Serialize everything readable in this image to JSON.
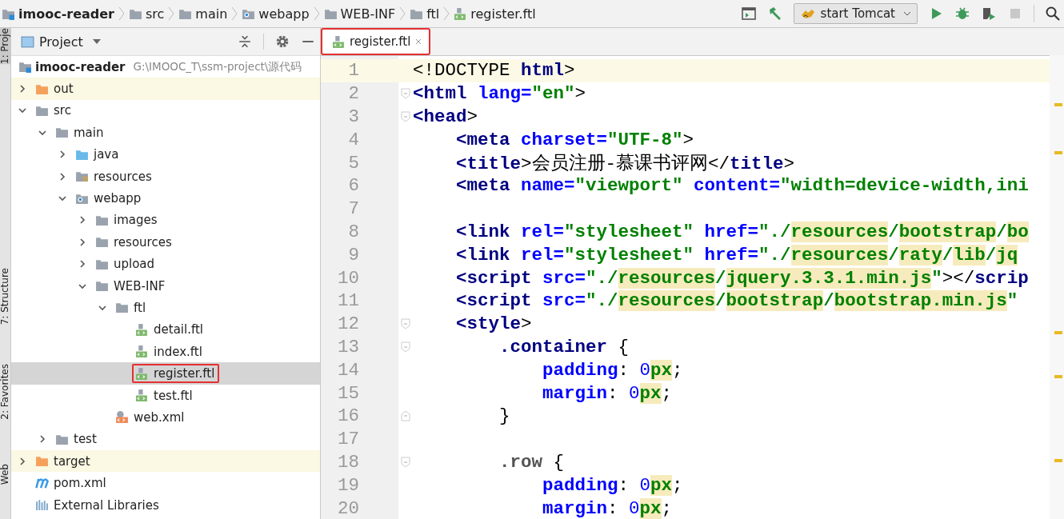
{
  "breadcrumbs": [
    {
      "label": "imooc-reader",
      "kind": "module"
    },
    {
      "label": "src",
      "kind": "folder"
    },
    {
      "label": "main",
      "kind": "folder"
    },
    {
      "label": "webapp",
      "kind": "web"
    },
    {
      "label": "WEB-INF",
      "kind": "folder"
    },
    {
      "label": "ftl",
      "kind": "folder"
    },
    {
      "label": "register.ftl",
      "kind": "ftl"
    }
  ],
  "run_config": {
    "label": "start Tomcat"
  },
  "side_tabs": [
    {
      "label": "1: Proje",
      "selected": true
    },
    {
      "label": "7: Structure",
      "selected": false
    },
    {
      "label": "2: Favorites",
      "selected": false
    },
    {
      "label": "Web",
      "selected": false
    }
  ],
  "project_panel": {
    "title": "Project"
  },
  "editor_tabs": [
    {
      "label": "register.ftl",
      "selected": true,
      "outlined": true
    }
  ],
  "project_root": {
    "label": "imooc-reader",
    "location": "G:\\IMOOC_T\\ssm-project\\源代码"
  },
  "tree": [
    {
      "label": "out",
      "kind": "excluded",
      "expanded": false
    },
    {
      "label": "src",
      "kind": "folder",
      "expanded": true,
      "children": [
        {
          "label": "main",
          "kind": "folder",
          "expanded": true,
          "children": [
            {
              "label": "java",
              "kind": "source",
              "expanded": false
            },
            {
              "label": "resources",
              "kind": "resources",
              "expanded": false
            },
            {
              "label": "webapp",
              "kind": "web",
              "expanded": true,
              "children": [
                {
                  "label": "images",
                  "kind": "folder",
                  "expanded": false
                },
                {
                  "label": "resources",
                  "kind": "folder",
                  "expanded": false
                },
                {
                  "label": "upload",
                  "kind": "folder",
                  "expanded": false
                },
                {
                  "label": "WEB-INF",
                  "kind": "folder",
                  "expanded": true,
                  "children": [
                    {
                      "label": "ftl",
                      "kind": "folder",
                      "expanded": true,
                      "children": [
                        {
                          "label": "detail.ftl",
                          "kind": "ftl",
                          "selected": false,
                          "outlined": false
                        },
                        {
                          "label": "index.ftl",
                          "kind": "ftl",
                          "selected": false,
                          "outlined": false
                        },
                        {
                          "label": "register.ftl",
                          "kind": "ftl",
                          "selected": true,
                          "outlined": true
                        },
                        {
                          "label": "test.ftl",
                          "kind": "ftl",
                          "selected": false,
                          "outlined": false
                        }
                      ]
                    },
                    {
                      "label": "web.xml",
                      "kind": "xml",
                      "selected": false,
                      "outlined": false
                    }
                  ]
                }
              ]
            }
          ]
        },
        {
          "label": "test",
          "kind": "folder",
          "expanded": false
        }
      ]
    },
    {
      "label": "target",
      "kind": "excluded",
      "expanded": false
    },
    {
      "label": "pom.xml",
      "kind": "maven"
    },
    {
      "label": "External Libraries",
      "kind": "libraries"
    }
  ],
  "code": [
    {
      "n": "1",
      "current": true,
      "tokens": [
        {
          "t": "<!DOCTYPE ",
          "kind": "plain"
        },
        {
          "t": "html",
          "kind": "tag"
        },
        {
          "t": ">",
          "kind": "plain"
        }
      ]
    },
    {
      "n": "2",
      "current": false,
      "fold_start": true,
      "tokens": [
        {
          "t": "<html ",
          "kind": "tag"
        },
        {
          "t": "lang=",
          "kind": "attr"
        },
        {
          "t": "\"en\"",
          "kind": "str"
        },
        {
          "t": ">",
          "kind": "plain"
        }
      ]
    },
    {
      "n": "3",
      "current": false,
      "fold_start": true,
      "tokens": [
        {
          "t": "<head",
          "kind": "tag"
        },
        {
          "t": ">",
          "kind": "plain"
        }
      ]
    },
    {
      "n": "4",
      "current": false,
      "tokens": [
        {
          "t": "    <meta ",
          "kind": "tag"
        },
        {
          "t": "charset=",
          "kind": "attr"
        },
        {
          "t": "\"UTF-8\"",
          "kind": "str"
        },
        {
          "t": ">",
          "kind": "plain"
        }
      ]
    },
    {
      "n": "5",
      "current": false,
      "tokens": [
        {
          "t": "    <title",
          "kind": "tag"
        },
        {
          "t": ">会员注册-慕课书评网</",
          "kind": "plain"
        },
        {
          "t": "title",
          "kind": "tag"
        },
        {
          "t": ">",
          "kind": "plain"
        }
      ]
    },
    {
      "n": "6",
      "current": false,
      "tokens": [
        {
          "t": "    <meta ",
          "kind": "tag"
        },
        {
          "t": "name=",
          "kind": "attr"
        },
        {
          "t": "\"viewport\" ",
          "kind": "str"
        },
        {
          "t": "content=",
          "kind": "attr"
        },
        {
          "t": "\"width=device-width,ini",
          "kind": "str"
        }
      ]
    },
    {
      "n": "7",
      "current": false
    },
    {
      "n": "8",
      "current": false,
      "tokens": [
        {
          "t": "    <link ",
          "kind": "tag"
        },
        {
          "t": "rel=",
          "kind": "attr"
        },
        {
          "t": "\"stylesheet\" ",
          "kind": "str"
        },
        {
          "t": "href=",
          "kind": "attr"
        },
        {
          "t": "\"./",
          "kind": "str"
        },
        {
          "t": "resources",
          "kind": "path"
        },
        {
          "t": "/",
          "kind": "str"
        },
        {
          "t": "bootstrap",
          "kind": "path"
        },
        {
          "t": "/",
          "kind": "str"
        },
        {
          "t": "bo",
          "kind": "path"
        }
      ]
    },
    {
      "n": "9",
      "current": false,
      "tokens": [
        {
          "t": "    <link ",
          "kind": "tag"
        },
        {
          "t": "rel=",
          "kind": "attr"
        },
        {
          "t": "\"stylesheet\" ",
          "kind": "str"
        },
        {
          "t": "href=",
          "kind": "attr"
        },
        {
          "t": "\"./",
          "kind": "str"
        },
        {
          "t": "resources",
          "kind": "path"
        },
        {
          "t": "/",
          "kind": "str"
        },
        {
          "t": "raty",
          "kind": "path"
        },
        {
          "t": "/",
          "kind": "str"
        },
        {
          "t": "lib",
          "kind": "path"
        },
        {
          "t": "/",
          "kind": "str"
        },
        {
          "t": "jq",
          "kind": "path"
        }
      ]
    },
    {
      "n": "10",
      "current": false,
      "tokens": [
        {
          "t": "    <script ",
          "kind": "tag"
        },
        {
          "t": "src=",
          "kind": "attr"
        },
        {
          "t": "\"./",
          "kind": "str"
        },
        {
          "t": "resources",
          "kind": "path"
        },
        {
          "t": "/",
          "kind": "str"
        },
        {
          "t": "jquery.3.3.1.min.js",
          "kind": "path"
        },
        {
          "t": "\"",
          "kind": "str"
        },
        {
          "t": "></",
          "kind": "plain"
        },
        {
          "t": "scrip",
          "kind": "tag"
        }
      ]
    },
    {
      "n": "11",
      "current": false,
      "tokens": [
        {
          "t": "    <script ",
          "kind": "tag"
        },
        {
          "t": "src=",
          "kind": "attr"
        },
        {
          "t": "\"./",
          "kind": "str"
        },
        {
          "t": "resources",
          "kind": "path"
        },
        {
          "t": "/",
          "kind": "str"
        },
        {
          "t": "bootstrap",
          "kind": "path"
        },
        {
          "t": "/",
          "kind": "str"
        },
        {
          "t": "bootstrap.min.js",
          "kind": "path"
        },
        {
          "t": "\"",
          "kind": "str"
        }
      ]
    },
    {
      "n": "12",
      "current": false,
      "fold_start": true,
      "tokens": [
        {
          "t": "    <style",
          "kind": "tag"
        },
        {
          "t": ">",
          "kind": "plain"
        }
      ]
    },
    {
      "n": "13",
      "current": false,
      "fold_start": true,
      "tokens": [
        {
          "t": "        .container",
          "kind": "tag"
        },
        {
          "t": " {",
          "kind": "plain"
        }
      ]
    },
    {
      "n": "14",
      "current": false,
      "tokens": [
        {
          "t": "            padding",
          "kind": "attr"
        },
        {
          "t": ": ",
          "kind": "plain"
        },
        {
          "t": "0",
          "kind": "num"
        },
        {
          "t": "px",
          "kind": "unit"
        },
        {
          "t": ";",
          "kind": "plain"
        }
      ]
    },
    {
      "n": "15",
      "current": false,
      "tokens": [
        {
          "t": "            margin",
          "kind": "attr"
        },
        {
          "t": ": ",
          "kind": "plain"
        },
        {
          "t": "0",
          "kind": "num"
        },
        {
          "t": "px",
          "kind": "unit"
        },
        {
          "t": ";",
          "kind": "plain"
        }
      ]
    },
    {
      "n": "16",
      "current": false,
      "fold_end": true,
      "tokens": [
        {
          "t": "        }",
          "kind": "plain"
        }
      ]
    },
    {
      "n": "17",
      "current": false
    },
    {
      "n": "18",
      "current": false,
      "fold_start": true,
      "tokens": [
        {
          "t": "        .row",
          "kind": "sel"
        },
        {
          "t": " {",
          "kind": "plain"
        }
      ]
    },
    {
      "n": "19",
      "current": false,
      "tokens": [
        {
          "t": "            padding",
          "kind": "attr"
        },
        {
          "t": ": ",
          "kind": "plain"
        },
        {
          "t": "0",
          "kind": "num"
        },
        {
          "t": "px",
          "kind": "unit"
        },
        {
          "t": ";",
          "kind": "plain"
        }
      ]
    },
    {
      "n": "20",
      "current": false,
      "tokens": [
        {
          "t": "            margin",
          "kind": "attr"
        },
        {
          "t": ": ",
          "kind": "plain"
        },
        {
          "t": "0",
          "kind": "num"
        },
        {
          "t": "px",
          "kind": "unit"
        },
        {
          "t": ";",
          "kind": "plain"
        }
      ]
    }
  ]
}
